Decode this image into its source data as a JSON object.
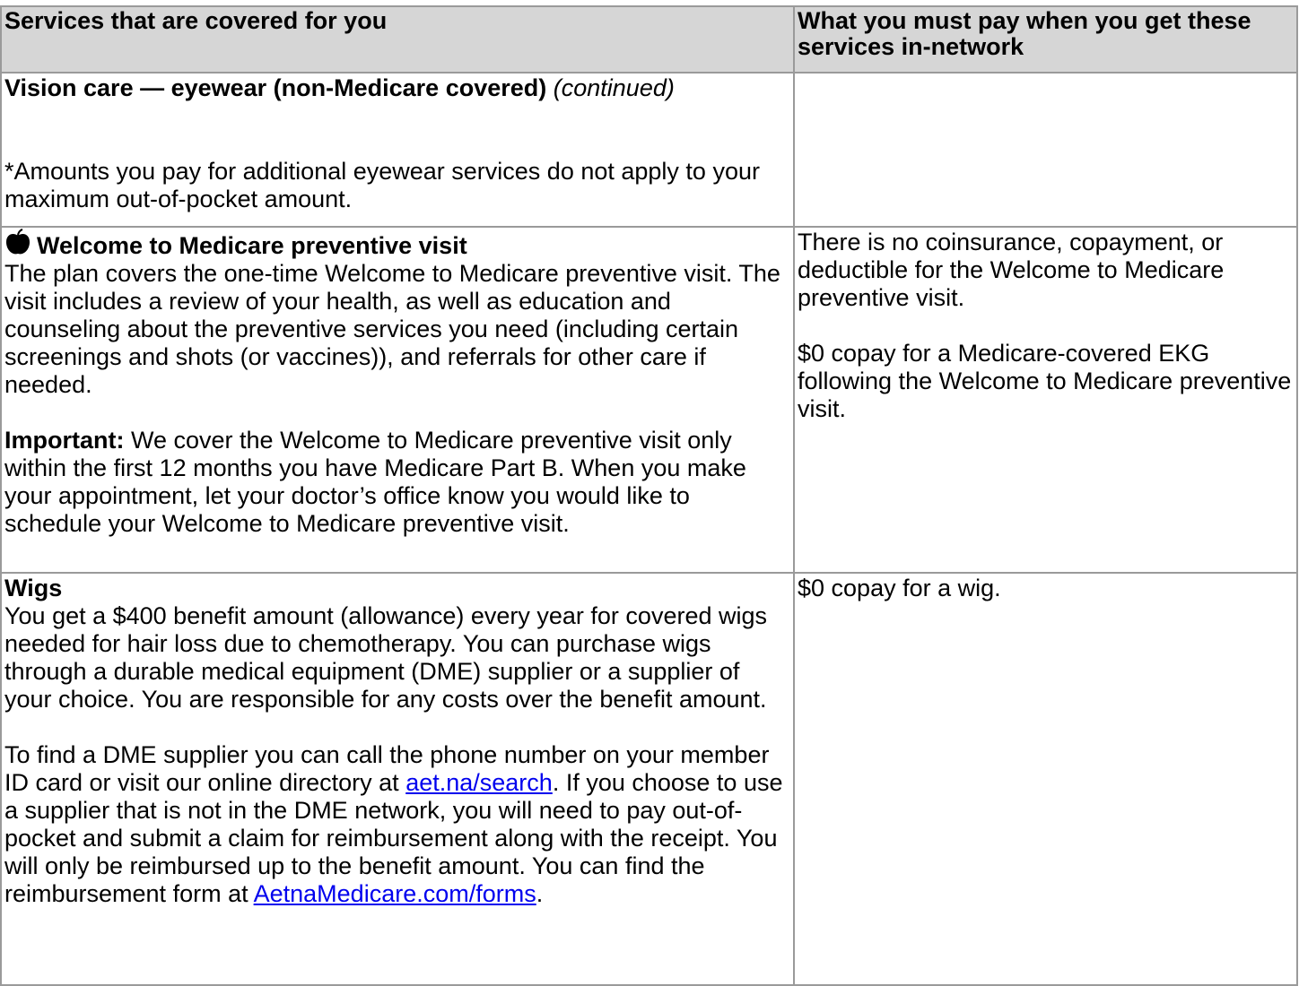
{
  "header": {
    "col1": "Services that are covered for you",
    "col2": "What you must pay when you get these services in-network"
  },
  "vision": {
    "title": "Vision care — eyewear (non-Medicare covered)",
    "continued": "(continued)",
    "note": "*Amounts you pay for additional eyewear services do not apply to your maximum out-of-pocket amount."
  },
  "welcome": {
    "icon": "apple-icon",
    "title": "Welcome to Medicare preventive visit",
    "desc": "The plan covers the one-time Welcome to Medicare preventive visit. The visit includes a review of your health, as well as education and counseling about the preventive services you need (including certain screenings and shots (or vaccines)), and referrals for other care if needed.",
    "important_label": "Important:",
    "important_text": "We cover the Welcome to Medicare preventive visit only within the first 12 months you have Medicare Part B. When you make your appointment, let your doctor’s office know you would like to schedule your Welcome to Medicare preventive visit.",
    "cost1": "There is no coinsurance, copayment, or deductible for the Welcome to Medicare preventive visit.",
    "cost2": "$0 copay for a Medicare-covered EKG following the Welcome to Medicare preventive visit."
  },
  "wigs": {
    "title": "Wigs",
    "desc": "You get a $400 benefit amount (allowance) every year for covered wigs needed for hair loss due to chemotherapy. You can purchase wigs through a durable medical equipment (DME) supplier or a supplier of your choice. You are responsible for any costs over the benefit amount.",
    "find_pre": "To find a DME supplier you can call the phone number on your member ID card or visit our online directory at",
    "link1": "aet.na/search",
    "find_post": ". If you choose to use a supplier that is not in the DME network, you will need to pay out-of-pocket and submit a claim for reimbursement along with the receipt. You will only be reimbursed up to the benefit amount. You can find the reimbursement form at",
    "link2": "AetnaMedicare.com/forms",
    "end": ".",
    "cost": "$0 copay for a wig."
  }
}
